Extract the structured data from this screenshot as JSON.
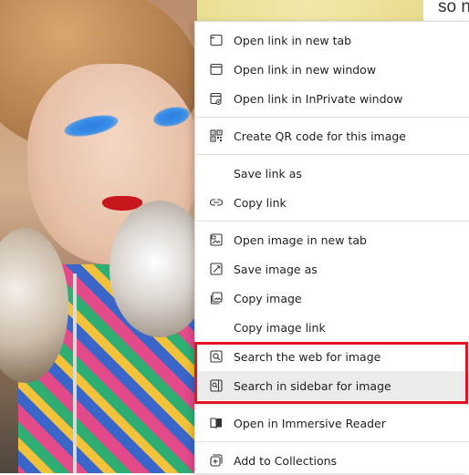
{
  "page": {
    "corner_text": "so n"
  },
  "context_menu": {
    "groups": [
      [
        {
          "label": "Open link in new tab",
          "icon": "new-tab-icon"
        },
        {
          "label": "Open link in new window",
          "icon": "new-window-icon"
        },
        {
          "label": "Open link in InPrivate window",
          "icon": "inprivate-window-icon"
        }
      ],
      [
        {
          "label": "Create QR code for this image",
          "icon": "qr-code-icon"
        }
      ],
      [
        {
          "label": "Save link as",
          "icon": ""
        },
        {
          "label": "Copy link",
          "icon": "link-icon"
        }
      ],
      [
        {
          "label": "Open image in new tab",
          "icon": "image-new-tab-icon"
        },
        {
          "label": "Save image as",
          "icon": "save-image-icon"
        },
        {
          "label": "Copy image",
          "icon": "copy-image-icon"
        },
        {
          "label": "Copy image link",
          "icon": ""
        },
        {
          "label": "Search the web for image",
          "icon": "visual-search-icon"
        },
        {
          "label": "Search in sidebar for image",
          "icon": "sidebar-search-icon",
          "hovered": true
        }
      ],
      [
        {
          "label": "Open in Immersive Reader",
          "icon": "immersive-reader-icon"
        }
      ],
      [
        {
          "label": "Add to Collections",
          "icon": "collections-icon"
        }
      ]
    ]
  },
  "colors": {
    "highlight_border": "#e3151e",
    "hover_bg": "#ebebeb"
  }
}
